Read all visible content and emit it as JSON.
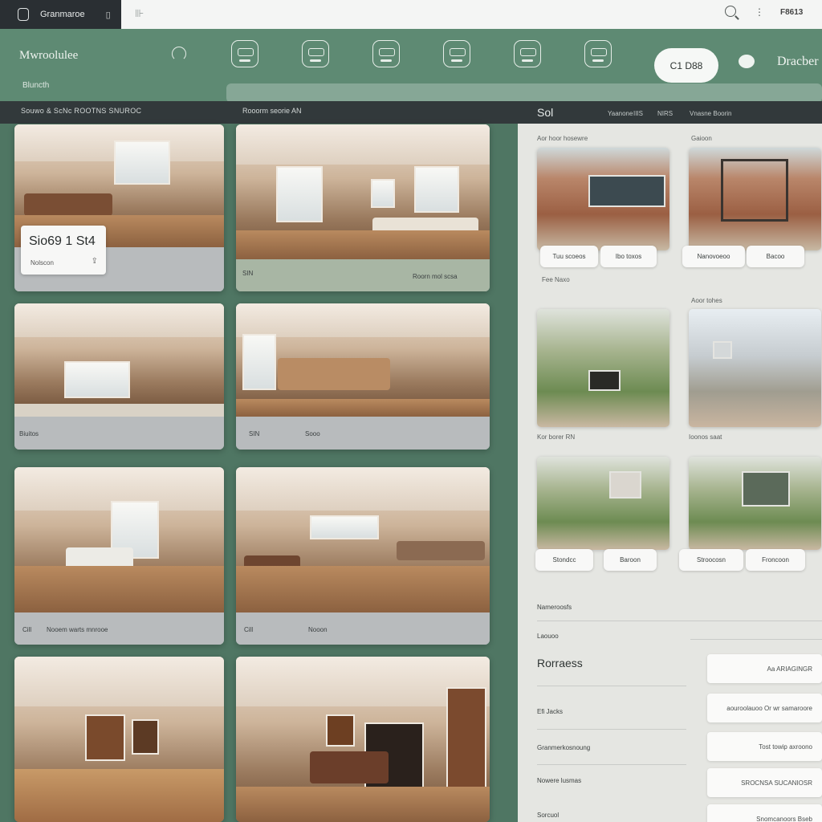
{
  "topbar": {
    "app_name": "Granmaroe",
    "label": "F8613"
  },
  "header": {
    "brand": "Mwroolulee",
    "subtitle": "Bluncth",
    "pill_label": "C1 D88",
    "right_label": "Dracber"
  },
  "strip": {
    "left_label": "Souwo & ScNc ROOTNS SNUROC",
    "mid_label": "Rooorm seorie AN"
  },
  "panel_head": {
    "title": "Sol",
    "items": [
      "Yaanone",
      "IIIS",
      "NIRS",
      "Vnasne Boorin"
    ]
  },
  "cards": [
    {
      "caption_a": "",
      "caption_b": ""
    },
    {
      "caption_a": "SIN",
      "caption_b": "Roorn mol scsa"
    },
    {
      "caption_a": "Biuitos",
      "caption_b": ""
    },
    {
      "caption_a": "SIN",
      "caption_b": "Sooo"
    },
    {
      "caption_a": "Cill",
      "caption_b": "Nooem warts mnrooe"
    },
    {
      "caption_a": "Cill",
      "caption_b": "Nooon"
    },
    {
      "caption_a": "",
      "caption_b": ""
    },
    {
      "caption_a": "",
      "caption_b": ""
    }
  ],
  "badge": {
    "title": "Sio69 1 St4",
    "sub": "Nolscon"
  },
  "rpanel": {
    "top_label": "Aor hoor hosewre",
    "top_label_r": "Gaioon",
    "chips": [
      "Tuu scoeos",
      "Ibo toxos",
      "Nanovoeoo",
      "Bacoo",
      "Stondcc",
      "Baroon",
      "Stroocosn",
      "Froncoon"
    ],
    "row_labels": [
      "Fee Naxo",
      "Aoor tohes",
      "Kor borer RN",
      "Ioonos saat"
    ],
    "section_label": "Nameroosfs",
    "sub_label": "Laouoo",
    "heading": "Rorraess",
    "fields": [
      {
        "label": "",
        "value": "Aa ARIAGINGR"
      },
      {
        "label": "Efi Jacks",
        "value": "aouroolauoo Or wr samaroore"
      },
      {
        "label": "Granmerkosnoung",
        "value": "Tost towip axroono"
      },
      {
        "label": "Nowere lusmas",
        "value": "SROCNSA SUCANIOSR"
      },
      {
        "label": "Sorcuol",
        "value": "Snomcanoors Bseb"
      }
    ]
  }
}
